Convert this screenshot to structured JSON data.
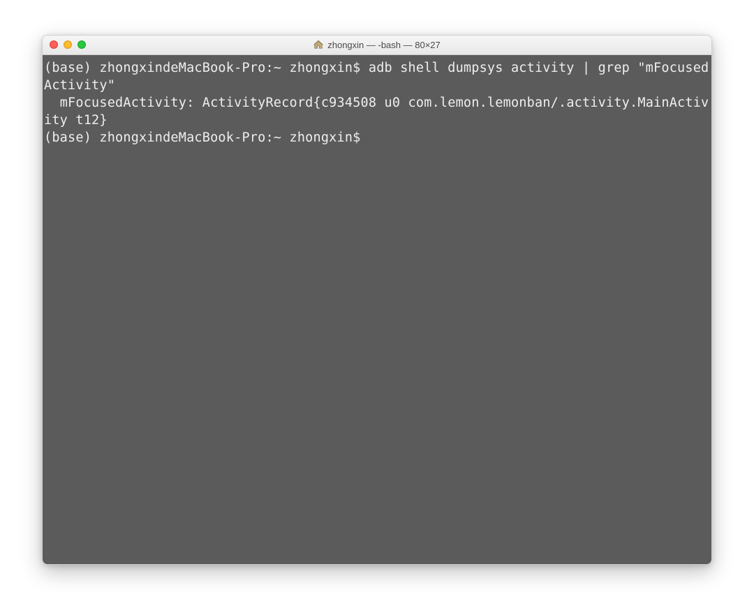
{
  "window": {
    "title": "zhongxin — -bash — 80×27"
  },
  "terminal": {
    "lines": [
      "(base) zhongxindeMacBook-Pro:~ zhongxin$ adb shell dumpsys activity | grep \"mFocusedActivity\"",
      "  mFocusedActivity: ActivityRecord{c934508 u0 com.lemon.lemonban/.activity.MainActivity t12}",
      "(base) zhongxindeMacBook-Pro:~ zhongxin$ "
    ]
  },
  "colors": {
    "bg": "#5b5b5b",
    "fg": "#eeeeee",
    "titlebar_top": "#f6f6f6",
    "titlebar_bottom": "#e8e8e8"
  }
}
